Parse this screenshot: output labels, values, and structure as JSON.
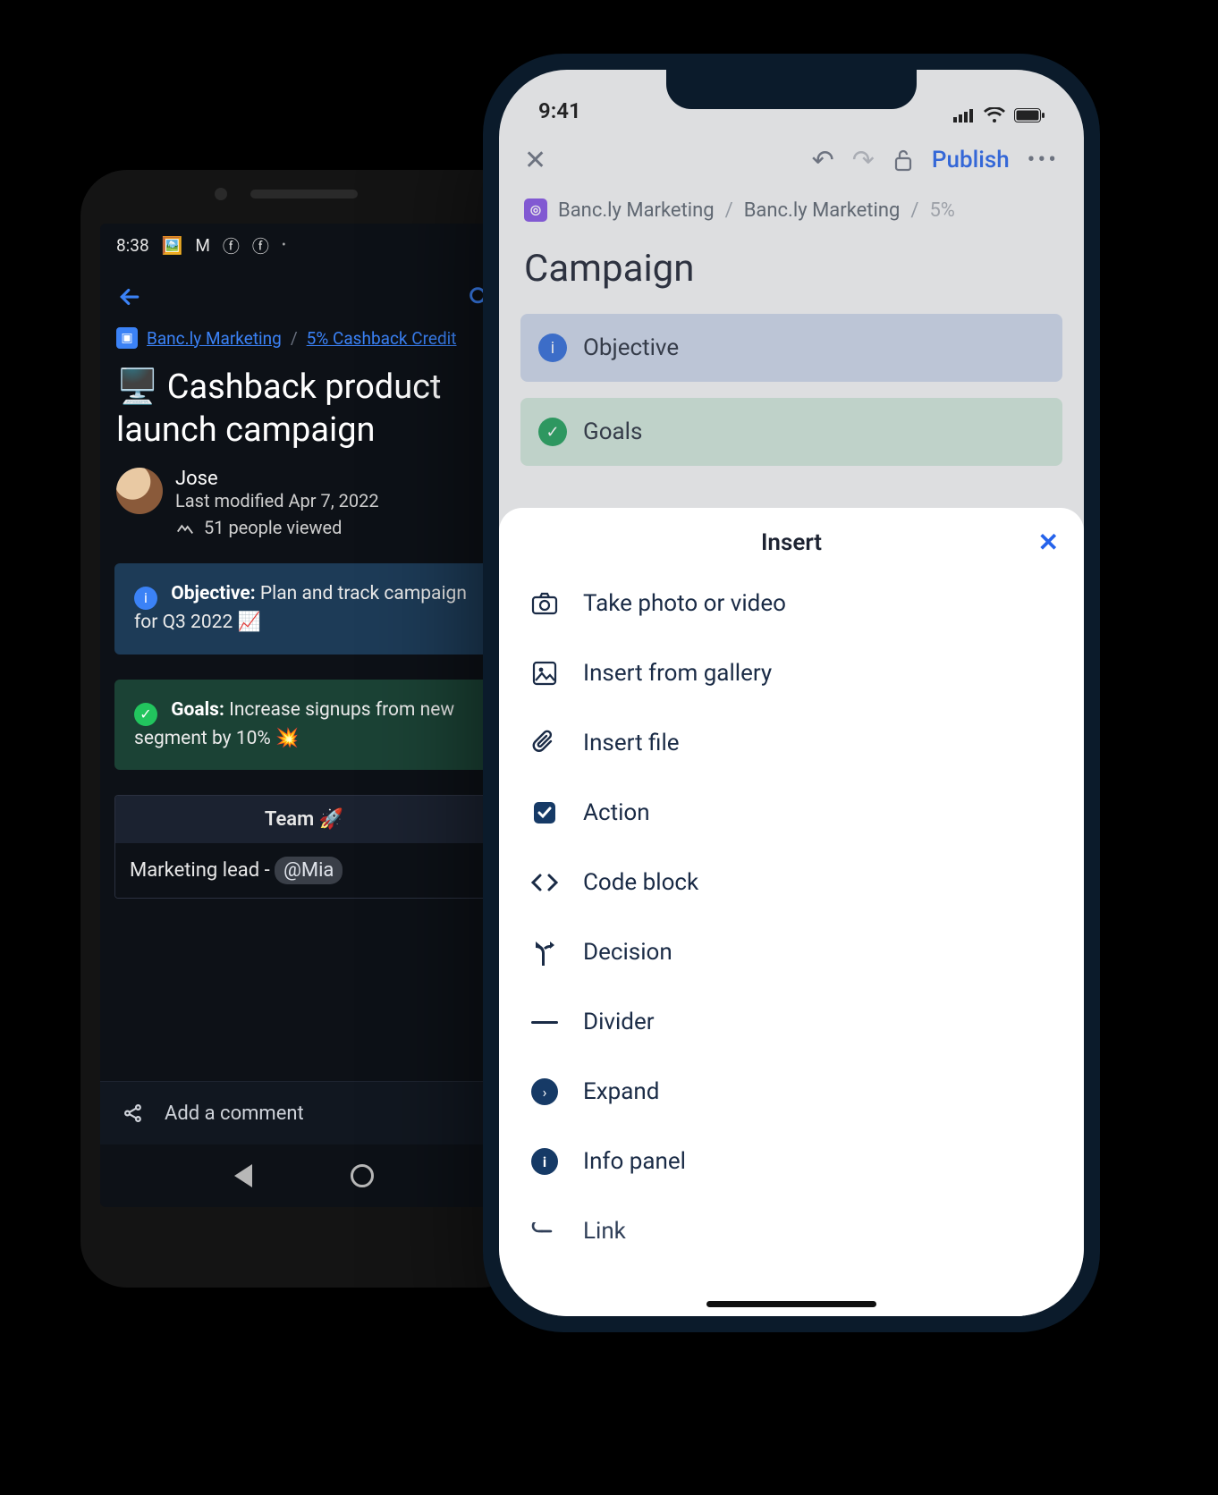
{
  "android": {
    "status_time": "8:38",
    "breadcrumb": {
      "space": "Banc.ly Marketing",
      "page": "5% Cashback Credit"
    },
    "title": "🖥️ Cashback product launch campaign",
    "author": {
      "name": "Jose",
      "modified": "Last modified Apr 7, 2022",
      "views": "51 people viewed"
    },
    "objective": {
      "label": "Objective:",
      "text": "Plan and track campaign for Q3 2022 📈"
    },
    "goals": {
      "label": "Goals:",
      "text": "Increase signups from new segment by 10% 💥"
    },
    "table": {
      "header": "Team 🚀",
      "row_prefix": "Marketing lead - ",
      "mention": "@Mia"
    },
    "comment_placeholder": "Add a comment"
  },
  "iphone": {
    "status_time": "9:41",
    "toolbar": {
      "publish": "Publish"
    },
    "breadcrumb": {
      "a": "Banc.ly Marketing",
      "b": "Banc.ly Marketing",
      "c": "5%"
    },
    "title": "Campaign",
    "objective_label": "Objective",
    "goals_label": "Goals",
    "sheet": {
      "title": "Insert",
      "items": {
        "take_photo": "Take photo or video",
        "gallery": "Insert from gallery",
        "file": "Insert file",
        "action": "Action",
        "code": "Code block",
        "decision": "Decision",
        "divider": "Divider",
        "expand": "Expand",
        "info_panel": "Info panel",
        "link": "Link"
      }
    }
  }
}
